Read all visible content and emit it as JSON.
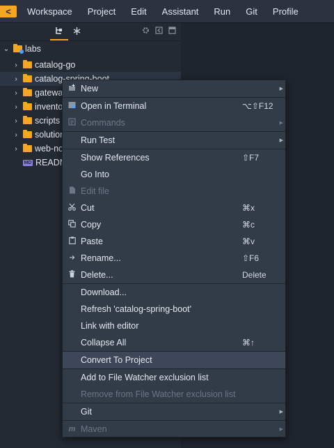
{
  "menubar": {
    "back_glyph": "<",
    "items": [
      "Workspace",
      "Project",
      "Edit",
      "Assistant",
      "Run",
      "Git",
      "Profile"
    ]
  },
  "toolbar": {
    "icons": [
      "project-tree-icon",
      "structure-icon",
      "gear-icon",
      "collapse-icon",
      "layout-icon"
    ]
  },
  "tree": {
    "root": "labs",
    "items": [
      "catalog-go",
      "catalog-spring-boot",
      "gateway",
      "inventory",
      "scripts",
      "solutions",
      "web-nodejs",
      "README"
    ],
    "readme_badge": "MD"
  },
  "context_menu": {
    "items": [
      {
        "label": "New",
        "submenu": true,
        "icon": "new-file-icon"
      },
      {
        "label": "Open in Terminal",
        "shortcut": "⌥⇧F12",
        "icon": "terminal-icon"
      },
      {
        "label": "Commands",
        "submenu": true,
        "disabled": true,
        "icon": "commands-icon"
      },
      {
        "label": "Run Test",
        "submenu": true
      },
      {
        "label": "Show References",
        "shortcut": "⇧F7"
      },
      {
        "label": "Go Into"
      },
      {
        "label": "Edit file",
        "disabled": true,
        "icon": "edit-file-icon"
      },
      {
        "label": "Cut",
        "shortcut": "⌘x",
        "icon": "scissors-icon"
      },
      {
        "label": "Copy",
        "shortcut": "⌘c",
        "icon": "copy-icon"
      },
      {
        "label": "Paste",
        "shortcut": "⌘v",
        "icon": "paste-icon"
      },
      {
        "label": "Rename...",
        "shortcut": "⇧F6",
        "icon": "rename-icon"
      },
      {
        "label": "Delete...",
        "shortcut": "Delete",
        "icon": "trash-icon"
      },
      {
        "label": "Download..."
      },
      {
        "label": "Refresh 'catalog-spring-boot'"
      },
      {
        "label": "Link with editor"
      },
      {
        "label": "Collapse All",
        "shortcut": "⌘↑"
      },
      {
        "label": "Convert To Project",
        "highlighted": true
      },
      {
        "label": "Add to File Watcher exclusion list"
      },
      {
        "label": "Remove from File Watcher exclusion list",
        "disabled": true
      },
      {
        "label": "Git",
        "submenu": true
      },
      {
        "label": "Maven",
        "submenu": true,
        "disabled": true,
        "icon": "maven-icon",
        "icon_glyph": "m"
      }
    ]
  },
  "colors": {
    "accent": "#f5a623",
    "menubar_bg": "#2b3340",
    "panel_bg": "#232a34",
    "menu_bg": "#323b48",
    "menu_highlight": "#3d4757"
  }
}
